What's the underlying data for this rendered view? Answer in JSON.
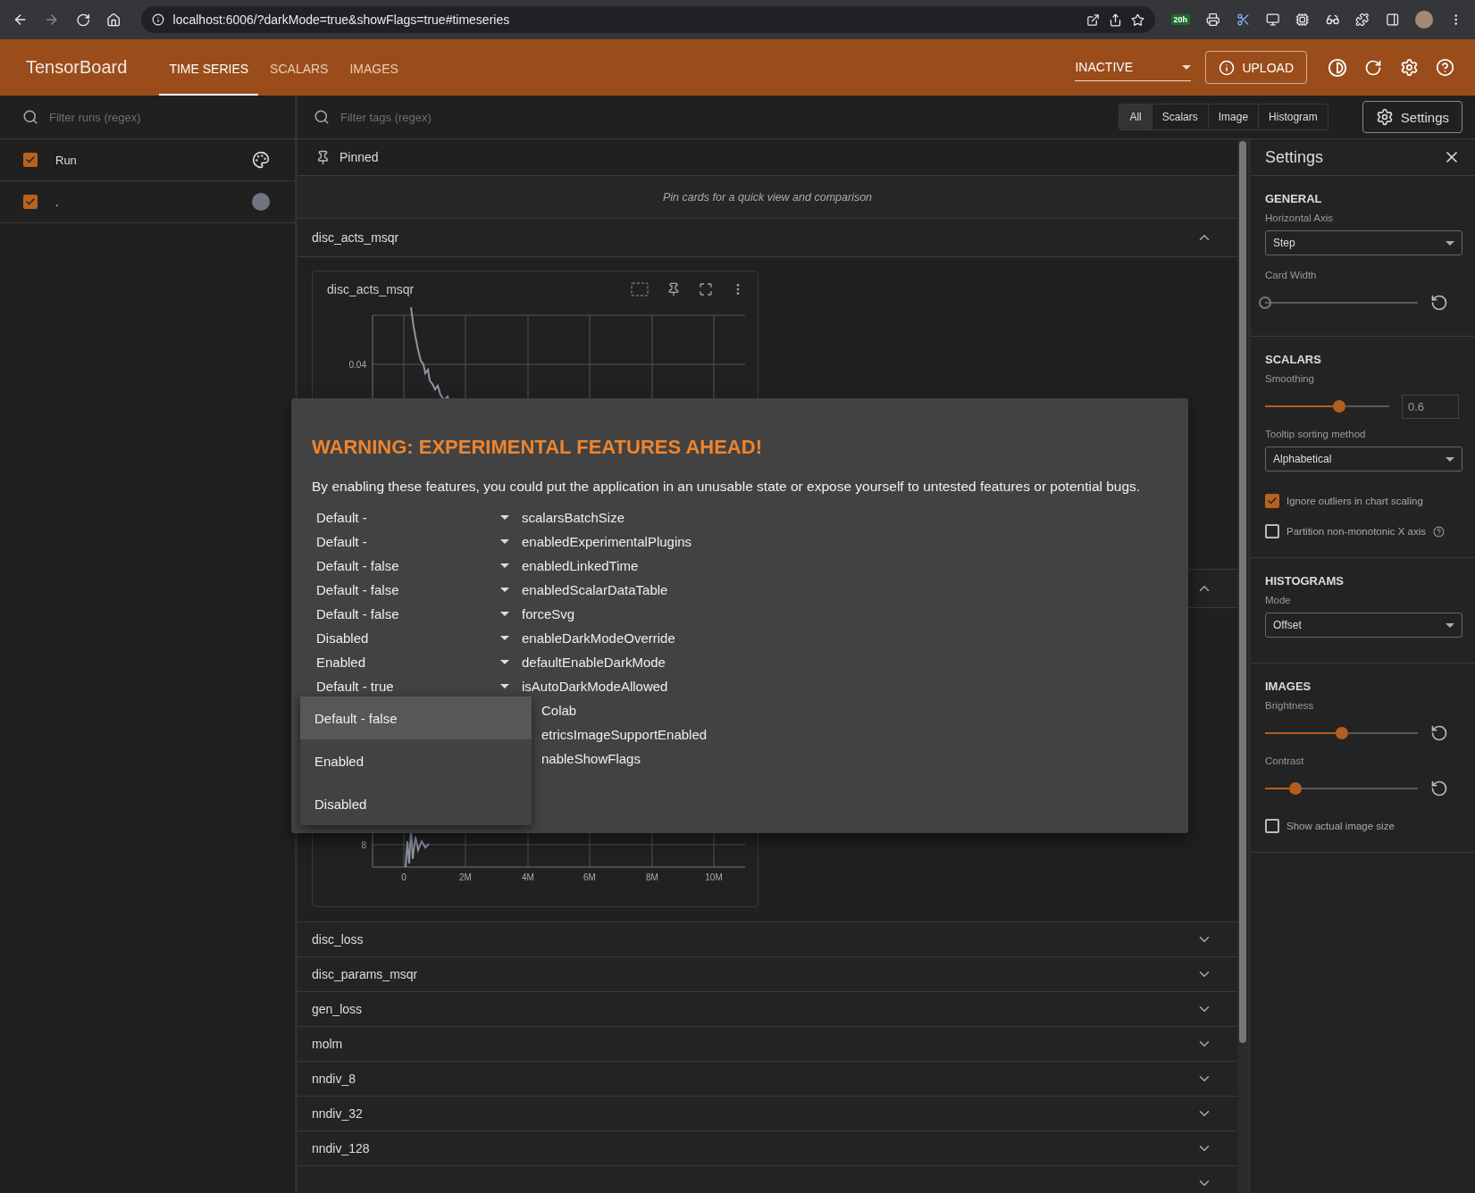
{
  "browser": {
    "url": "localhost:6006/?darkMode=true&showFlags=true#timeseries",
    "badge": "20h"
  },
  "header": {
    "title": "TensorBoard",
    "tabs": [
      {
        "label": "TIME SERIES",
        "selected": true
      },
      {
        "label": "SCALARS",
        "selected": false
      },
      {
        "label": "IMAGES",
        "selected": false
      }
    ],
    "plugin_select": "INACTIVE",
    "upload_button": "UPLOAD"
  },
  "toolbar": {
    "runs_placeholder": "Filter runs (regex)",
    "tags_placeholder": "Filter tags (regex)",
    "type_filters": [
      {
        "label": "All",
        "selected": true
      },
      {
        "label": "Scalars",
        "selected": false
      },
      {
        "label": "Image",
        "selected": false
      },
      {
        "label": "Histogram",
        "selected": false
      }
    ],
    "settings_button": "Settings"
  },
  "runs": [
    {
      "name": "Run",
      "checked": true,
      "kind": "header"
    },
    {
      "name": ".",
      "checked": true,
      "kind": "run",
      "color": "#6f7682"
    }
  ],
  "pinned": {
    "title": "Pinned",
    "empty_message": "Pin cards for a quick view and comparison"
  },
  "groups": [
    {
      "name": "disc_acts_msqr",
      "expanded": true,
      "cards": [
        {
          "title": "disc_acts_msqr",
          "y_ticks": [
            "0.04"
          ]
        }
      ]
    },
    {
      "expanded": true,
      "cards": [
        {
          "y_ticks": [
            "8"
          ],
          "x_ticks": [
            "0",
            "2M",
            "4M",
            "6M",
            "8M",
            "10M"
          ]
        }
      ]
    },
    {
      "name": "disc_loss",
      "expanded": false
    },
    {
      "name": "disc_params_msqr",
      "expanded": false
    },
    {
      "name": "gen_loss",
      "expanded": false
    },
    {
      "name": "molm",
      "expanded": false
    },
    {
      "name": "nndiv_8",
      "expanded": false
    },
    {
      "name": "nndiv_32",
      "expanded": false
    },
    {
      "name": "nndiv_128",
      "expanded": false
    },
    {
      "expanded": false
    }
  ],
  "settings": {
    "title": "Settings",
    "sections": [
      {
        "title": "GENERAL",
        "controls": [
          {
            "kind": "select",
            "label": "Horizontal Axis",
            "value": "Step"
          },
          {
            "kind": "slider",
            "label": "Card Width",
            "level": 0
          }
        ]
      },
      {
        "title": "SCALARS",
        "controls": [
          {
            "kind": "input_slider",
            "label": "Smoothing",
            "level": 0.6,
            "value": "0.6"
          },
          {
            "kind": "select",
            "label": "Tooltip sorting method",
            "value": "Alphabetical"
          },
          {
            "kind": "checkbox",
            "label": "Ignore outliers in chart scaling",
            "checked": true
          },
          {
            "kind": "checkbox",
            "label": "Partition non-monotonic X axis",
            "checked": false,
            "help": true
          }
        ]
      },
      {
        "title": "HISTOGRAMS",
        "controls": [
          {
            "kind": "select",
            "label": "Mode",
            "value": "Offset"
          }
        ]
      },
      {
        "title": "IMAGES",
        "controls": [
          {
            "kind": "slider",
            "label": "Brightness",
            "level": 0.5
          },
          {
            "kind": "slider",
            "label": "Contrast",
            "level": 0.2
          },
          {
            "kind": "checkbox",
            "label": "Show actual image size",
            "checked": false
          }
        ]
      }
    ]
  },
  "dialog": {
    "title": "WARNING: EXPERIMENTAL FEATURES AHEAD!",
    "message": "By enabling these features, you could put the application in an unusable state or expose yourself to untested features or potential bugs.",
    "flags": [
      {
        "value": "Default -",
        "name": "scalarsBatchSize"
      },
      {
        "value": "Default -",
        "name": "enabledExperimentalPlugins"
      },
      {
        "value": "Default - false",
        "name": "enabledLinkedTime"
      },
      {
        "value": "Default - false",
        "name": "enabledScalarDataTable"
      },
      {
        "value": "Default - false",
        "name": "forceSvg"
      },
      {
        "value": "Disabled",
        "name": "enableDarkModeOverride"
      },
      {
        "value": "Enabled",
        "name": "defaultEnableDarkMode"
      },
      {
        "value": "Default - true",
        "name": "isAutoDarkModeAllowed"
      },
      {
        "name": "Colab"
      },
      {
        "name": "etricsImageSupportEnabled"
      },
      {
        "name": "nableShowFlags"
      }
    ],
    "menu": [
      {
        "label": "Default - false",
        "selected": true
      },
      {
        "label": "Enabled",
        "selected": false
      },
      {
        "label": "Disabled",
        "selected": false
      }
    ]
  }
}
